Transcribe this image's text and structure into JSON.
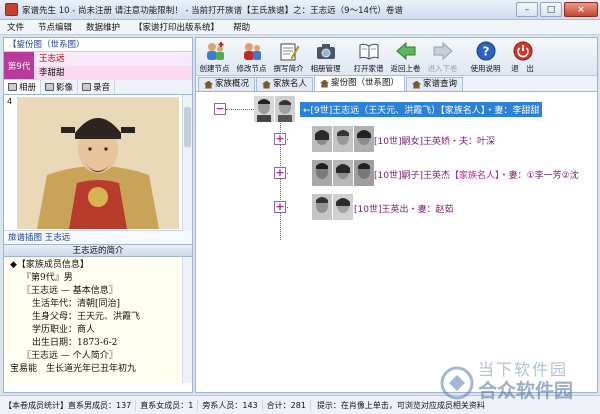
{
  "window": {
    "title": "家谱先生 10 - 尚未注册 请注意功能限制！ - 当前打开族谱【王氏族谱】之：王志远（9～14代）卷谱",
    "min_label": "–",
    "max_label": "□",
    "close_label": "×"
  },
  "menu": [
    "文件",
    "节点编辑",
    "数据维护",
    "【家谱打印出版系统】",
    "帮助"
  ],
  "left": {
    "tree_header": "【鋆份图（世系图）",
    "generation_label": "第9代",
    "generation_names": [
      "王志远",
      "李甜甜"
    ],
    "media_tabs": [
      "相册",
      "影像",
      "录音"
    ],
    "photo_count": "4",
    "photo_caption": "旅谱插图 王志远",
    "intro_header": "王志远的简介",
    "intro_lines": [
      "◆【家族成员信息】",
      "『第9代』男",
      "〖王志远 — 基本信息〗",
      "生活年代：清朝[同治]",
      "生身父母：王天元、洪霞飞",
      "学历职业：商人",
      "出生日期：1873-6-2",
      "〖王志远 — 个人简介〗",
      "宝易能　生长道光年已丑年初九"
    ]
  },
  "toolbar": {
    "buttons": [
      "创建节点",
      "修改节点",
      "撰写简介",
      "相册管理",
      "打开家谱",
      "返回上卷",
      "进入下卷",
      "使用说明",
      "退　出"
    ]
  },
  "tabs": [
    "家族概况",
    "家族名人",
    "鋆份图（世系图）",
    "家谱查询"
  ],
  "tree": {
    "root": {
      "expand_symbol": "−",
      "prefix": "←[9世]王志远（王天元、洪霞飞）",
      "famous": "【家族名人】",
      "suffix": "・妻：李甜甜"
    },
    "children": [
      {
        "expand_symbol": "+",
        "prefix": "[10世]嗣女]王英娇・夫：叶深",
        "famous": "",
        "suffix": ""
      },
      {
        "expand_symbol": "+",
        "prefix": "[10世]嗣子]王英杰",
        "famous": "【家族名人】",
        "suffix": "・妻：①李一芳②沈"
      },
      {
        "expand_symbol": "+",
        "prefix": "[10世]王英出・妻：赵茹",
        "famous": "",
        "suffix": ""
      }
    ]
  },
  "status": {
    "stats": [
      "【本卷成员统计】直系男成员：137",
      "直系女成员：1",
      "旁系人员：143",
      "合计：281"
    ],
    "tip": "提示：在肖像上单击，可浏览对应成员相关资料"
  },
  "watermark": {
    "line1": "当下软件园",
    "line2": "合众软件园"
  },
  "colors": {
    "accent": "#2a82d8",
    "generation_bg": "#b93a9a",
    "name_red": "#c00000"
  }
}
